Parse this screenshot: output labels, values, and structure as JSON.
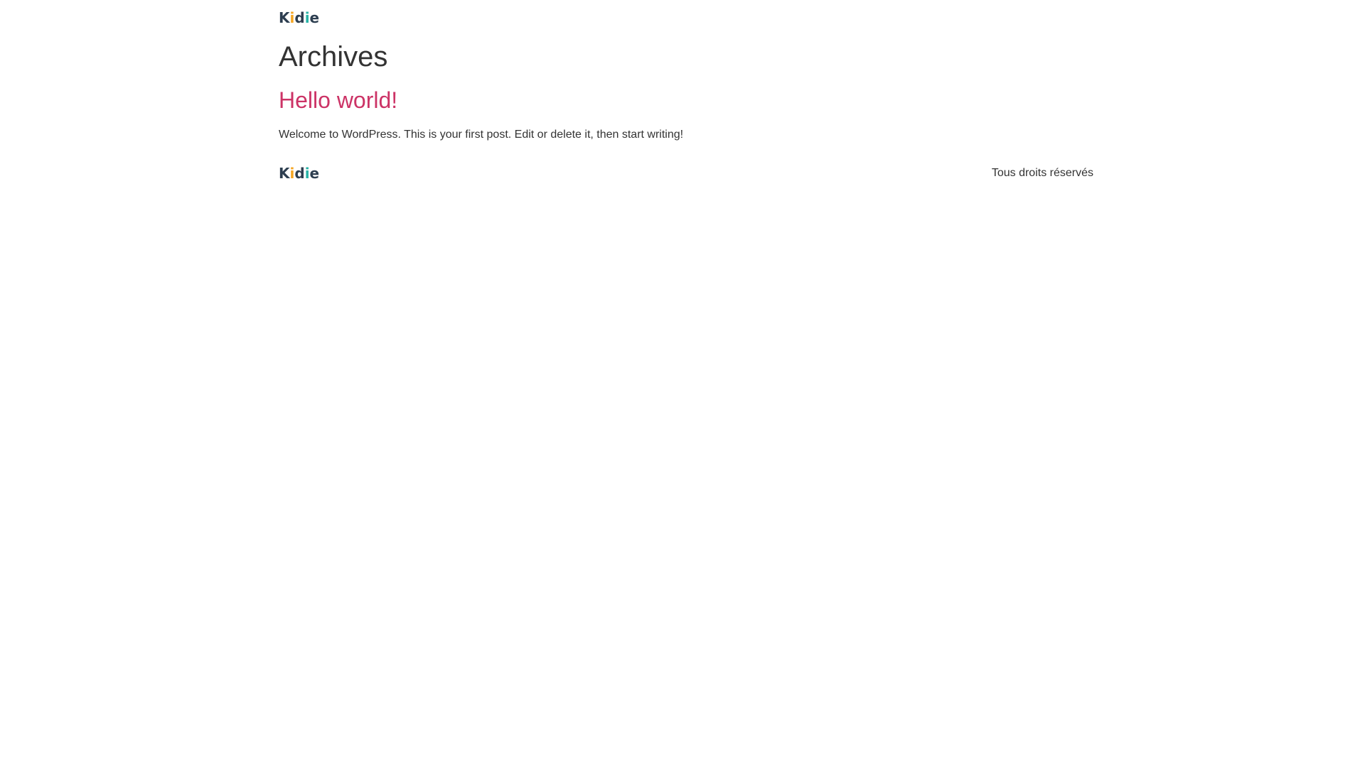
{
  "header": {
    "logo": {
      "letters": [
        "K",
        "i",
        "d",
        "i",
        "e"
      ],
      "colors": [
        "#2d3e50",
        "#f5a623",
        "#2d3e50",
        "#27b3a6",
        "#2d3e50"
      ]
    }
  },
  "main": {
    "page_title": "Archives",
    "posts": [
      {
        "title": "Hello world!",
        "excerpt": "Welcome to WordPress. This is your first post. Edit or delete it, then start writing!"
      }
    ]
  },
  "footer": {
    "logo": {
      "letters": [
        "K",
        "i",
        "d",
        "i",
        "e"
      ],
      "colors": [
        "#2d3e50",
        "#f5a623",
        "#2d3e50",
        "#27b3a6",
        "#2d3e50"
      ]
    },
    "copyright": "Tous droits réservés"
  },
  "colors": {
    "accent": "#cc3366",
    "text": "#333333"
  }
}
